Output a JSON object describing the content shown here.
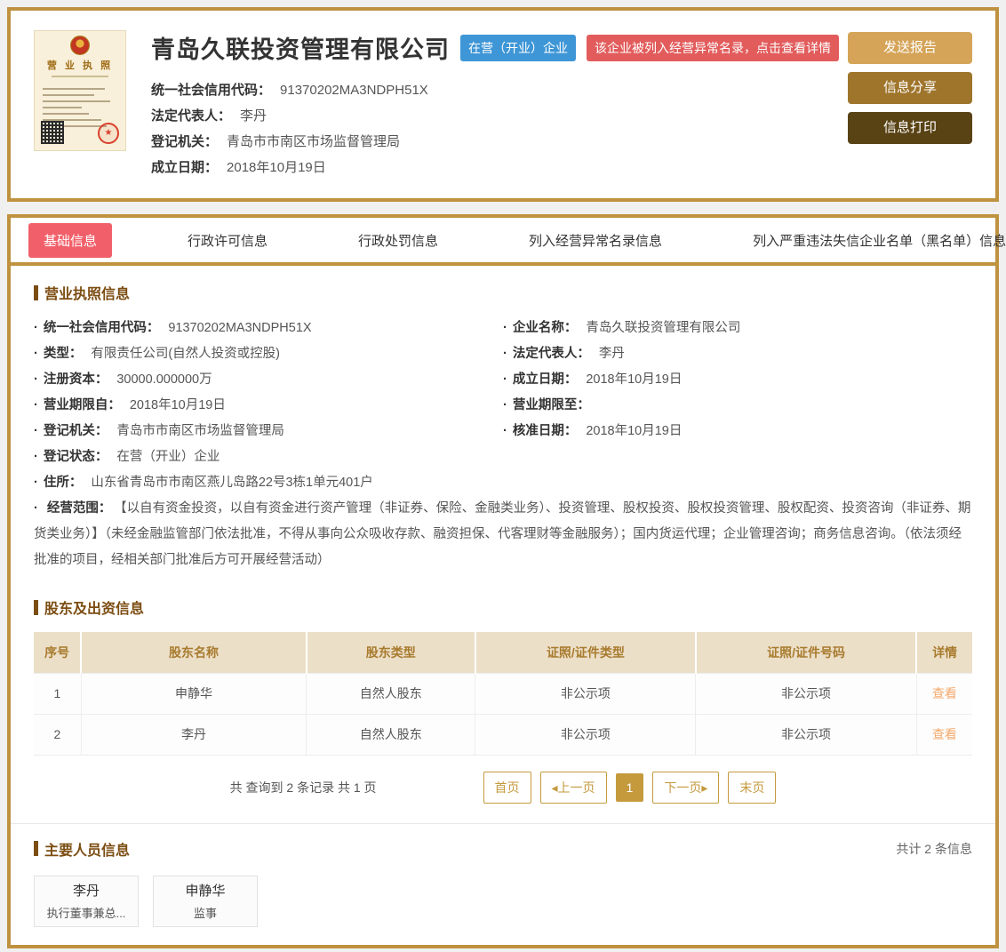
{
  "colors": {
    "gold_border": "#bf9240",
    "accent_gold": "#c49a3d",
    "tab_active_red": "#f1606a",
    "badge_blue": "#3e96d6",
    "badge_red": "#e25c5c",
    "section_title_brown": "#7c4d12",
    "table_header_bg": "#ecdfc8",
    "table_header_text": "#a87b2e",
    "view_link_orange": "#f5a96b"
  },
  "header": {
    "license_thumb_title": "营 业 执 照",
    "seal_glyph": "★",
    "company_name": "青岛久联投资管理有限公司",
    "status_badge": "在营（开业）企业",
    "warning_badge": "该企业被列入经营异常名录，点击查看详情",
    "fields": [
      {
        "label": "统一社会信用代码：",
        "value": "91370202MA3NDPH51X"
      },
      {
        "label": "法定代表人：",
        "value": "李丹"
      },
      {
        "label": "登记机关：",
        "value": "青岛市市南区市场监督管理局"
      },
      {
        "label": "成立日期：",
        "value": "2018年10月19日"
      }
    ],
    "buttons": [
      {
        "label": "发送报告"
      },
      {
        "label": "信息分享"
      },
      {
        "label": "信息打印"
      }
    ]
  },
  "tabs": [
    {
      "label": "基础信息"
    },
    {
      "label": "行政许可信息"
    },
    {
      "label": "行政处罚信息"
    },
    {
      "label": "列入经营异常名录信息"
    },
    {
      "label": "列入严重违法失信企业名单（黑名单）信息"
    }
  ],
  "license_section": {
    "title": "营业执照信息",
    "left_fields": [
      {
        "label": "统一社会信用代码：",
        "value": "91370202MA3NDPH51X"
      },
      {
        "label": "类型：",
        "value": "有限责任公司(自然人投资或控股)"
      },
      {
        "label": "注册资本：",
        "value": "30000.000000万"
      },
      {
        "label": "营业期限自：",
        "value": "2018年10月19日"
      },
      {
        "label": "登记机关：",
        "value": "青岛市市南区市场监督管理局"
      },
      {
        "label": "登记状态：",
        "value": "在营（开业）企业"
      },
      {
        "label": "住所：",
        "value": "山东省青岛市市南区燕儿岛路22号3栋1单元401户"
      }
    ],
    "right_fields": [
      {
        "label": "企业名称：",
        "value": "青岛久联投资管理有限公司"
      },
      {
        "label": "法定代表人：",
        "value": "李丹"
      },
      {
        "label": "成立日期：",
        "value": "2018年10月19日"
      },
      {
        "label": "营业期限至：",
        "value": ""
      },
      {
        "label": "核准日期：",
        "value": "2018年10月19日"
      }
    ],
    "scope": {
      "label": "经营范围：",
      "value": "【以自有资金投资，以自有资金进行资产管理（非证券、保险、金融类业务）、投资管理、股权投资、股权投资管理、股权配资、投资咨询（非证券、期货类业务）】（未经金融监管部门依法批准，不得从事向公众吸收存款、融资担保、代客理财等金融服务）；国内货运代理；企业管理咨询；商务信息咨询。（依法须经批准的项目，经相关部门批准后方可开展经营活动）"
    }
  },
  "shareholders_section": {
    "title": "股东及出资信息",
    "columns": [
      "序号",
      "股东名称",
      "股东类型",
      "证照/证件类型",
      "证照/证件号码",
      "详情"
    ],
    "rows": [
      {
        "no": "1",
        "name": "申静华",
        "type": "自然人股东",
        "cert_type": "非公示项",
        "cert_no": "非公示项",
        "detail": "查看"
      },
      {
        "no": "2",
        "name": "李丹",
        "type": "自然人股东",
        "cert_type": "非公示项",
        "cert_no": "非公示项",
        "detail": "查看"
      }
    ],
    "pagination": {
      "summary": "共 查询到 2 条记录 共 1 页",
      "first": "首页",
      "prev": "◂上一页",
      "current": "1",
      "next": "下一页▸",
      "last": "末页"
    }
  },
  "personnel_section": {
    "title": "主要人员信息",
    "count_text": "共计 2 条信息",
    "people": [
      {
        "name": "李丹",
        "role": "执行董事兼总..."
      },
      {
        "name": "申静华",
        "role": "监事"
      }
    ]
  }
}
